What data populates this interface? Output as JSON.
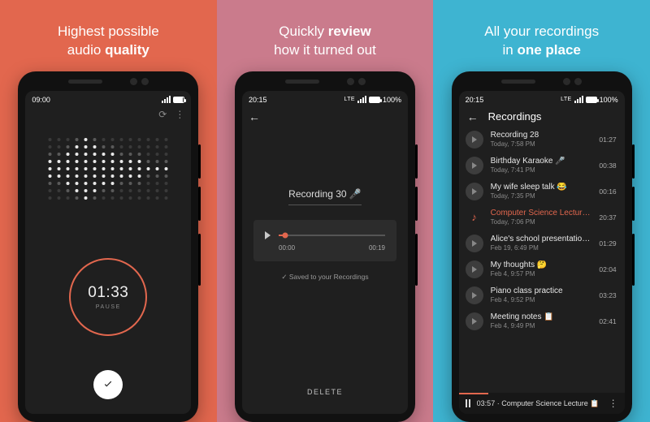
{
  "accent": "#e2674e",
  "panels": [
    {
      "caption_a": "Highest possible",
      "caption_b": "audio",
      "caption_bold": "quality"
    },
    {
      "caption_a": "Quickly",
      "caption_bold_inline": "review",
      "caption_b": "how it turned out"
    },
    {
      "caption_a": "All your recordings",
      "caption_b": "in",
      "caption_bold": "one place"
    }
  ],
  "p1": {
    "status_time": "09:00",
    "timer": "01:33",
    "pause_label": "PAUSE"
  },
  "p2": {
    "status_time": "20:15",
    "status_batt": "100%",
    "lte": "LTE",
    "title": "Recording 30 🎤",
    "pos": "00:00",
    "dur": "00:19",
    "saved": "Saved to your Recordings",
    "delete": "DELETE"
  },
  "p3": {
    "status_time": "20:15",
    "status_batt": "100%",
    "lte": "LTE",
    "header": "Recordings",
    "now_playing_prefix": "03:57 ·",
    "now_playing_title": "Computer Science Lecture 📋",
    "items": [
      {
        "title": "Recording 28",
        "sub": "Today, 7:58 PM",
        "dur": "01:27"
      },
      {
        "title": "Birthday Karaoke 🎤",
        "sub": "Today, 7:41 PM",
        "dur": "00:38"
      },
      {
        "title": "My wife sleep talk 😂",
        "sub": "Today, 7:35 PM",
        "dur": "00:16"
      },
      {
        "title": "Computer Science Lecture 📋",
        "sub": "Today, 7:06 PM",
        "dur": "20:37",
        "accent": true,
        "playing": true
      },
      {
        "title": "Alice's school presentation ❤️",
        "sub": "Feb 19, 6:49 PM",
        "dur": "01:29"
      },
      {
        "title": "My thoughts 🤔",
        "sub": "Feb 4, 9:57 PM",
        "dur": "02:04"
      },
      {
        "title": "Piano class practice",
        "sub": "Feb 4, 9:52 PM",
        "dur": "03:23"
      },
      {
        "title": "Meeting notes 📋",
        "sub": "Feb 4, 9:49 PM",
        "dur": "02:41"
      }
    ]
  }
}
